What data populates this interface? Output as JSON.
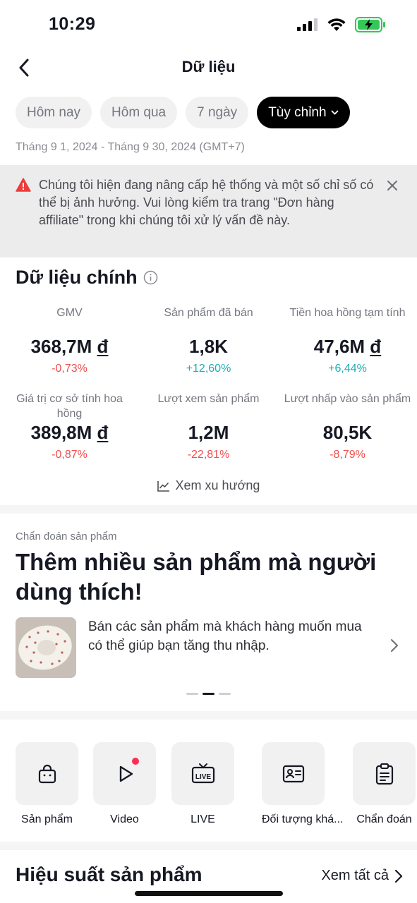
{
  "status_bar": {
    "time": "10:29"
  },
  "nav": {
    "title": "Dữ liệu"
  },
  "chips": [
    {
      "label": "Hôm nay",
      "active": false
    },
    {
      "label": "Hôm qua",
      "active": false
    },
    {
      "label": "7 ngày",
      "active": false
    },
    {
      "label": "Tùy chỉnh",
      "active": true
    }
  ],
  "date_range": "Tháng 9 1, 2024 - Tháng 9 30, 2024 (GMT+7)",
  "warning": {
    "text": "Chúng tôi hiện đang nâng cấp hệ thống và một số chỉ số có thể bị ảnh hưởng. Vui lòng kiểm tra trang \"Đơn hàng affiliate\" trong khi chúng tôi xử lý vấn đề này."
  },
  "key_metrics": {
    "title": "Dữ liệu chính",
    "items": [
      {
        "label": "GMV",
        "value": "368,7M",
        "currency": "đ",
        "change": "-0,73%",
        "trend": "down"
      },
      {
        "label": "Sản phẩm đã bán",
        "value": "1,8K",
        "currency": "",
        "change": "+12,60%",
        "trend": "up"
      },
      {
        "label": "Tiền hoa hồng tạm tính",
        "value": "47,6M",
        "currency": "đ",
        "change": "+6,44%",
        "trend": "up"
      },
      {
        "label": "Giá trị cơ sở tính hoa hồng",
        "value": "389,8M",
        "currency": "đ",
        "change": "-0,87%",
        "trend": "down"
      },
      {
        "label": "Lượt xem sản phẩm",
        "value": "1,2M",
        "currency": "",
        "change": "-22,81%",
        "trend": "down"
      },
      {
        "label": "Lượt nhấp vào sản phẩm",
        "value": "80,5K",
        "currency": "",
        "change": "-8,79%",
        "trend": "down"
      }
    ],
    "trend_link": "Xem xu hướng"
  },
  "diagnosis": {
    "kicker": "Chẩn đoán sản phẩm",
    "title": "Thêm nhiều sản phẩm mà người dùng thích!",
    "description": "Bán các sản phẩm mà khách hàng muốn mua có thể giúp bạn tăng thu nhập.",
    "pager": {
      "count": 3,
      "active": 1
    }
  },
  "shortcuts": [
    {
      "label": "Sản phẩm",
      "icon": "shopping-bag-icon"
    },
    {
      "label": "Video",
      "icon": "play-icon",
      "badge": true
    },
    {
      "label": "LIVE",
      "icon": "live-tv-icon"
    },
    {
      "label": "Đối tượng khá...",
      "icon": "id-card-icon"
    },
    {
      "label": "Chẩn đoán",
      "icon": "clipboard-icon"
    }
  ],
  "performance": {
    "title": "Hiệu suất sản phẩm",
    "view_all": "Xem tất cả"
  },
  "colors": {
    "negative": "#ef4f4f",
    "positive": "#1eacb5",
    "warning_icon": "#ee3b3b",
    "badge": "#fe2c55"
  }
}
